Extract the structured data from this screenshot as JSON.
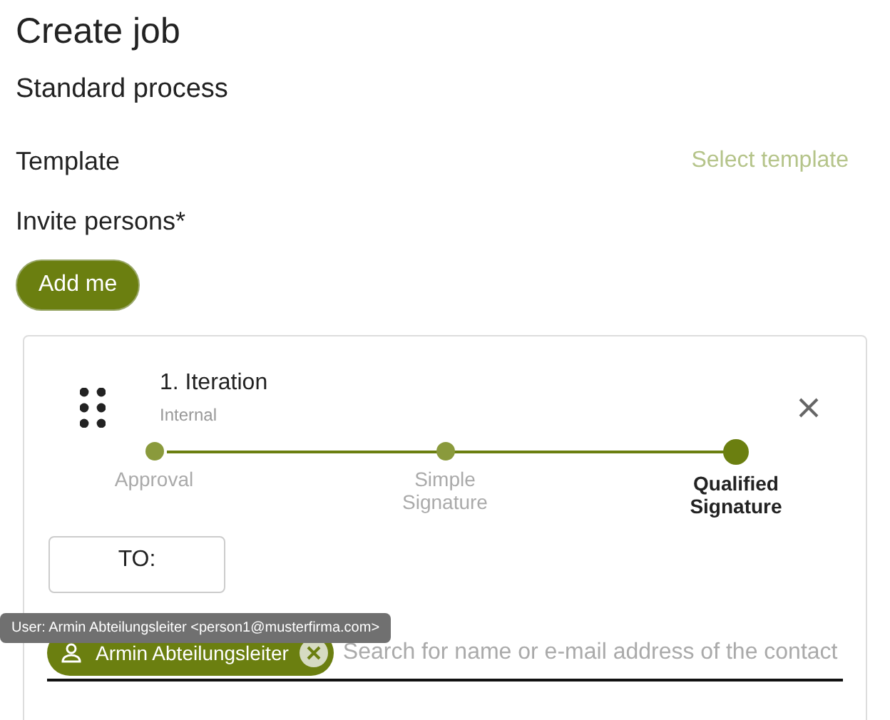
{
  "title": "Create job",
  "process": "Standard process",
  "template": {
    "label": "Template",
    "action": "Select template"
  },
  "invite": {
    "label": "Invite persons*",
    "button": "Add me"
  },
  "iteration": {
    "title": "1. Iteration",
    "subtitle": "Internal",
    "steps": [
      {
        "label": "Approval",
        "selected": false
      },
      {
        "label": "Simple Signature",
        "selected": false
      },
      {
        "label": "Qualified Signature",
        "selected": true
      }
    ],
    "to_button": "TO:",
    "tooltip": "User: Armin Abteilungsleiter <person1@musterfirma.com>",
    "chips": [
      {
        "label": "Armin Abteilungsleiter"
      }
    ],
    "search": {
      "placeholder": "Search for name or e-mail address of the contact"
    }
  }
}
